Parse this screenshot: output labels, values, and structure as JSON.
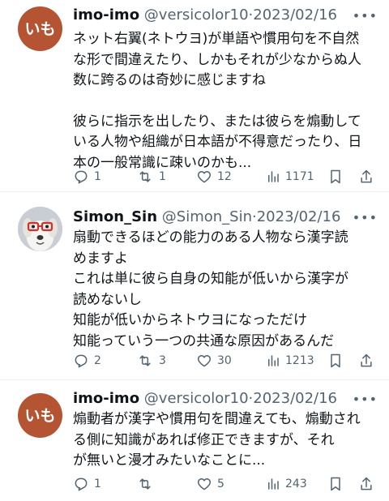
{
  "tweets": [
    {
      "display_name": "imo-imo",
      "handle": "@versicolor10",
      "dot": "·",
      "date": "2023/02/16",
      "avatar_text": "いも",
      "lines": [
        "ネット右翼(ネトウヨ)が単語や慣用句を不自然",
        "な形で間違えたり、しかもそれが少なからぬ人",
        "数に跨るのは奇妙に感じますね",
        "",
        "彼らに指示を出したり、または彼らを煽動して",
        "いる人物や組織が日本語が不得意だったり、日",
        "本の一般常識に疎いのかも..."
      ],
      "replies": "1",
      "retweets": "1",
      "likes": "12",
      "views": "1171"
    },
    {
      "display_name": "Simon_Sin",
      "handle": "@Simon_Sin",
      "dot": "·",
      "date": "2023/02/16",
      "lines": [
        "扇動できるほどの能力のある人物なら漢字読",
        "めますよ",
        "これは単に彼ら自身の知能が低いから漢字が",
        "読めないし",
        "知能が低いからネトウヨになっただけ",
        "知能っていう一つの共通な原因があるんだ"
      ],
      "replies": "2",
      "retweets": "3",
      "likes": "30",
      "views": "1213"
    },
    {
      "display_name": "imo-imo",
      "handle": "@versicolor10",
      "dot": "·",
      "date": "2023/02/16",
      "avatar_text": "いも",
      "lines": [
        "煽動者が漢字や慣用句を間違えても、煽動され",
        "る側に知識があれば修正できますが、それ",
        "が無いと漫才みたいなことに..."
      ],
      "replies": "1",
      "retweets": "",
      "likes": "5",
      "views": "243"
    }
  ],
  "colors": {
    "text": "#0f1419",
    "secondary": "#536471",
    "avatar_imo": "#b55433"
  },
  "icons": [
    "reply-icon",
    "retweet-icon",
    "like-icon",
    "views-icon",
    "bookmark-icon",
    "share-icon",
    "more-icon"
  ]
}
